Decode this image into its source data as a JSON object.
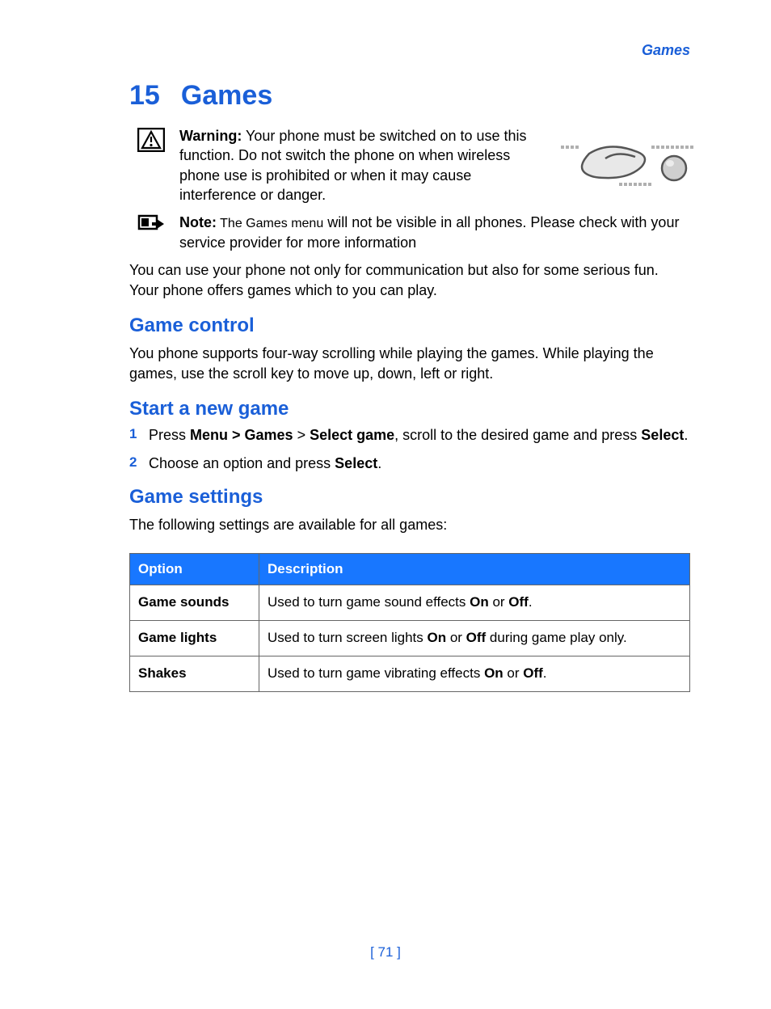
{
  "header": {
    "section": "Games"
  },
  "chapter": {
    "number": "15",
    "title": "Games"
  },
  "warning": {
    "label": "Warning:",
    "text": " Your phone must be switched on to use this function. Do not switch the phone on when wireless phone use is prohibited or when it may cause interference or danger."
  },
  "note": {
    "label": "Note:",
    "text_a": "  The Games menu",
    "text_b": " will not be visible in all phones. Please check with your service provider for more information"
  },
  "intro": "You can use your phone not only for communication but also for some serious fun. Your phone offers games which to you can play.",
  "sections": {
    "control": {
      "title": "Game control",
      "body": "You phone supports four-way scrolling while playing the games. While playing the games, use the scroll key to move up, down, left or right."
    },
    "start": {
      "title": "Start a new game",
      "steps": [
        {
          "n": "1",
          "pre": "Press ",
          "b1": "Menu > Games",
          "mid": " > ",
          "b2": "Select game",
          "post1": ", scroll to the desired game and press ",
          "b3": "Select",
          "end": "."
        },
        {
          "n": "2",
          "pre": "Choose an option and press ",
          "b1": "Select",
          "end": "."
        }
      ]
    },
    "settings": {
      "title": "Game settings",
      "body": "The following settings are available for all games:",
      "headers": {
        "opt": "Option",
        "desc": "Description"
      },
      "rows": [
        {
          "opt": "Game sounds",
          "d1": "Used to turn game sound effects ",
          "b1": "On",
          "d2": " or ",
          "b2": "Off",
          "d3": "."
        },
        {
          "opt": "Game lights",
          "d1": "Used to turn screen lights ",
          "b1": "On",
          "d2": " or ",
          "b2": "Off",
          "d3": " during game play only."
        },
        {
          "opt": "Shakes",
          "d1": "Used to turn game vibrating effects ",
          "b1": "On",
          "d2": " or ",
          "b2": "Off",
          "d3": "."
        }
      ]
    }
  },
  "footer": {
    "page": "[ 71 ]"
  }
}
